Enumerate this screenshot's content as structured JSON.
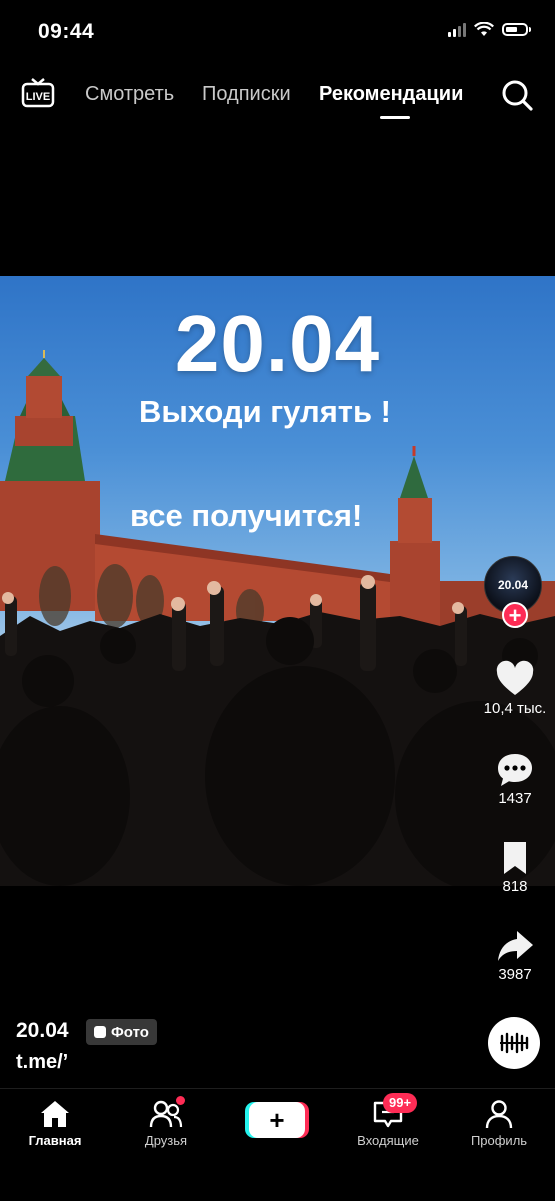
{
  "status_bar": {
    "time": "09:44"
  },
  "top_nav": {
    "live_label": "LIVE",
    "tabs": [
      {
        "label": "Смотреть",
        "active": false
      },
      {
        "label": "Подписки",
        "active": false
      },
      {
        "label": "Рекомендации",
        "active": true
      }
    ]
  },
  "video": {
    "title": "20.04",
    "line1": "Выходи гулять !",
    "line2": "все получится!"
  },
  "actions": {
    "avatar_text": "20.04",
    "follow_symbol": "+",
    "likes": "10,4 тыс.",
    "comments": "1437",
    "saves": "818",
    "shares": "3987"
  },
  "caption": {
    "author": "20.04",
    "badge": "Фото",
    "text": "t.me/’"
  },
  "bottom_nav": {
    "items": [
      {
        "label": "Главная",
        "icon": "home-icon",
        "active": true
      },
      {
        "label": "Друзья",
        "icon": "friends-icon",
        "active": false
      },
      {
        "label": "+",
        "icon": "create-icon",
        "active": false
      },
      {
        "label": "Входящие",
        "icon": "inbox-icon",
        "active": false
      },
      {
        "label": "Профиль",
        "icon": "profile-icon",
        "active": false
      }
    ],
    "inbox_badge": "99+"
  },
  "colors": {
    "accent": "#fe2c55",
    "cyan": "#25f4ee",
    "background": "#000000"
  }
}
